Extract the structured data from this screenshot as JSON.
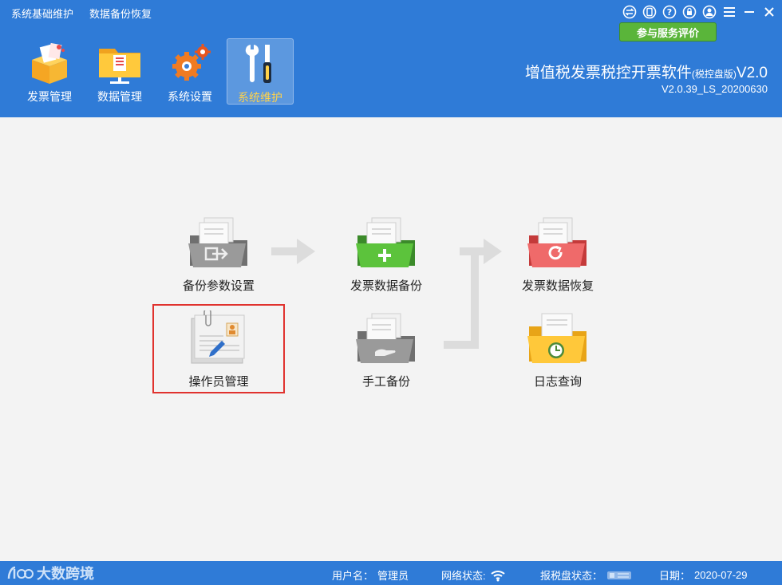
{
  "top_menu": [
    "系统基础维护",
    "数据备份恢复"
  ],
  "window_icons": [
    "swap-icon",
    "phone-icon",
    "help-icon",
    "lock-icon",
    "user-icon",
    "menu-icon",
    "minimize-icon",
    "close-icon"
  ],
  "eval_button": "参与服务评价",
  "nav": [
    {
      "label": "发票管理",
      "icon": "invoice-box-icon"
    },
    {
      "label": "数据管理",
      "icon": "data-folder-icon"
    },
    {
      "label": "系统设置",
      "icon": "gear-icon"
    },
    {
      "label": "系统维护",
      "icon": "tools-icon",
      "active": true
    }
  ],
  "app": {
    "title": "增值税发票税控开票软件",
    "edition": "(税控盘版)",
    "version_suffix": "V2.0",
    "version": "V2.0.39_LS_20200630"
  },
  "main_items": {
    "backup_params": "备份参数设置",
    "invoice_backup": "发票数据备份",
    "invoice_restore": "发票数据恢复",
    "operator_mgmt": "操作员管理",
    "manual_backup": "手工备份",
    "log_query": "日志查询"
  },
  "status": {
    "logo_text": "大数跨境",
    "username_label": "用户名：",
    "username": "管理员",
    "network_label": "网络状态:",
    "disk_label": "报税盘状态：",
    "date_label": "日期：",
    "date": "2020-07-29"
  },
  "colors": {
    "header_bg": "#2f7bd7",
    "eval_green": "#5ab53a",
    "highlight_red": "#e0322e",
    "active_label": "#ffd24a"
  }
}
